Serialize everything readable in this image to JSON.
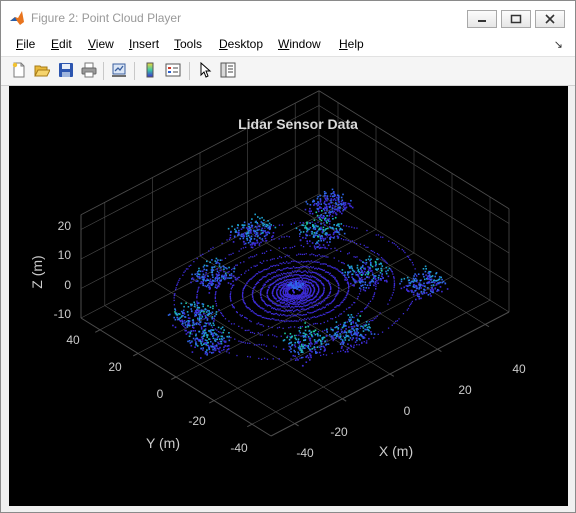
{
  "window": {
    "title": "Figure 2: Point Cloud Player",
    "controls": {
      "minimize": "minimize-icon",
      "maximize": "maximize-icon",
      "close": "close-icon"
    }
  },
  "menu": [
    {
      "label": "File",
      "u": "F",
      "rest": "ile"
    },
    {
      "label": "Edit",
      "u": "E",
      "rest": "dit"
    },
    {
      "label": "View",
      "u": "V",
      "rest": "iew"
    },
    {
      "label": "Insert",
      "u": "I",
      "rest": "nsert"
    },
    {
      "label": "Tools",
      "u": "T",
      "rest": "ools"
    },
    {
      "label": "Desktop",
      "u": "D",
      "rest": "esktop"
    },
    {
      "label": "Window",
      "u": "W",
      "rest": "indow"
    },
    {
      "label": "Help",
      "u": "H",
      "rest": "elp"
    }
  ],
  "menu_arrow": "↘",
  "toolbar": [
    "new-figure-icon",
    "open-file-icon",
    "save-icon",
    "print-icon",
    "link-plot-icon",
    "colorbar-icon",
    "legend-icon",
    "edit-plot-icon",
    "property-inspector-icon"
  ],
  "plot": {
    "title": "Lidar Sensor Data",
    "xlabel": "X (m)",
    "ylabel": "Y (m)",
    "zlabel": "Z (m)",
    "xticks": [
      "-40",
      "-20",
      "0",
      "20",
      "40"
    ],
    "yticks": [
      "-40",
      "-20",
      "0",
      "20",
      "40"
    ],
    "zticks": [
      "-10",
      "0",
      "10",
      "20"
    ],
    "background": "#000000",
    "axis_color": "#4d4d4d",
    "text_color": "#cccccc",
    "colormap": [
      "#3d2bd6",
      "#2f66e8",
      "#1fa2d0",
      "#1fc8a0",
      "#c8e036"
    ]
  }
}
